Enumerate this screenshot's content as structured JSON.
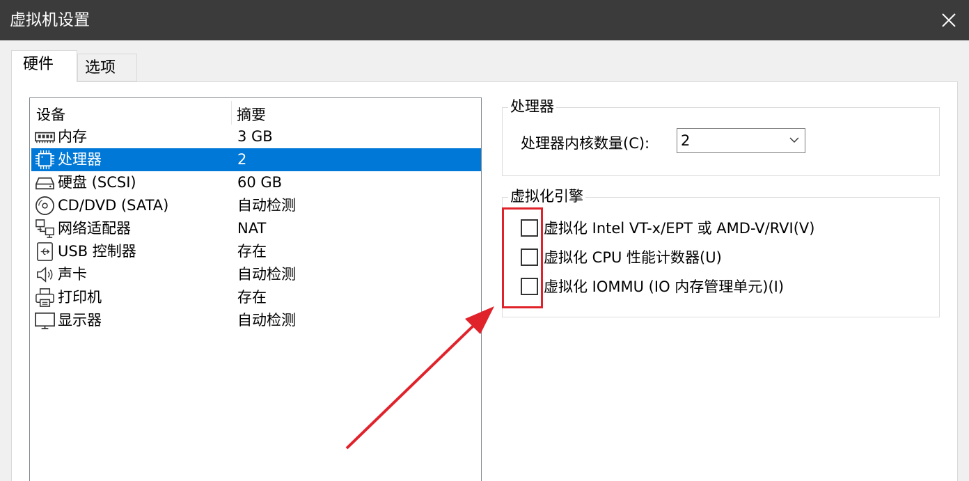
{
  "window": {
    "title": "虚拟机设置"
  },
  "tabs": [
    {
      "label": "硬件",
      "active": true
    },
    {
      "label": "选项",
      "active": false
    }
  ],
  "device_list": {
    "headers": {
      "device": "设备",
      "summary": "摘要"
    },
    "rows": [
      {
        "icon": "memory-icon",
        "name": "内存",
        "summary": "3 GB",
        "selected": false
      },
      {
        "icon": "cpu-icon",
        "name": "处理器",
        "summary": "2",
        "selected": true
      },
      {
        "icon": "harddisk-icon",
        "name": "硬盘 (SCSI)",
        "summary": "60 GB",
        "selected": false
      },
      {
        "icon": "cd-dvd-icon",
        "name": "CD/DVD (SATA)",
        "summary": "自动检测",
        "selected": false
      },
      {
        "icon": "network-adapter-icon",
        "name": "网络适配器",
        "summary": "NAT",
        "selected": false
      },
      {
        "icon": "usb-icon",
        "name": "USB 控制器",
        "summary": "存在",
        "selected": false
      },
      {
        "icon": "speaker-icon",
        "name": "声卡",
        "summary": "自动检测",
        "selected": false
      },
      {
        "icon": "printer-icon",
        "name": "打印机",
        "summary": "存在",
        "selected": false
      },
      {
        "icon": "monitor-icon",
        "name": "显示器",
        "summary": "自动检测",
        "selected": false
      }
    ]
  },
  "processor_group": {
    "legend": "处理器",
    "cores_label": "处理器内核数量(C):",
    "cores_value": "2"
  },
  "virtualization_group": {
    "legend": "虚拟化引擎",
    "options": [
      {
        "label": "虚拟化 Intel VT-x/EPT 或 AMD-V/RVI(V)",
        "checked": false
      },
      {
        "label": "虚拟化 CPU 性能计数器(U)",
        "checked": false
      },
      {
        "label": "虚拟化 IOMMU (IO 内存管理单元)(I)",
        "checked": false
      }
    ]
  },
  "colors": {
    "titlebar": "#3b3b3b",
    "selection": "#0078d7",
    "annotation": "#e0222b"
  }
}
